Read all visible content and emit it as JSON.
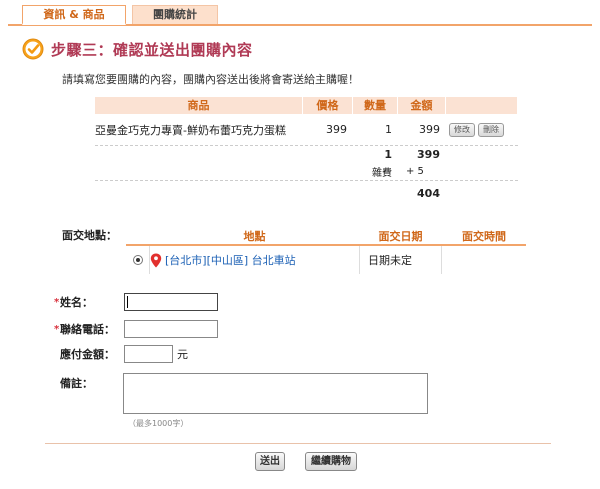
{
  "tabs": [
    {
      "label": "資訊 & 商品",
      "active": true
    },
    {
      "label": "團購統計",
      "active": false
    }
  ],
  "step": {
    "title": "步驟三：確認並送出團購內容"
  },
  "instruction": "請填寫您要團購的內容，團購內容送出後將會寄送給主購喔！",
  "products": {
    "headers": {
      "name": "商品",
      "price": "價格",
      "qty": "數量",
      "amount": "金額"
    },
    "rows": [
      {
        "name": "亞曼金巧克力專賣-鮮奶布蕾巧克力蛋糕",
        "price": "399",
        "qty": "1",
        "amount": "399",
        "edit_label": "修改",
        "delete_label": "刪除"
      }
    ],
    "subtotal_qty": "1",
    "subtotal_amount": "399",
    "fee_label": "雜費",
    "fee_value": "+ 5",
    "total": "404"
  },
  "meet": {
    "label": "面交地點：",
    "headers": {
      "location": "地點",
      "date": "面交日期",
      "time": "面交時間"
    },
    "rows": [
      {
        "location": "[台北市][中山區] 台北車站",
        "date": "日期未定",
        "time": ""
      }
    ]
  },
  "form": {
    "name_label": "姓名：",
    "phone_label": "聯絡電話：",
    "pay_label": "應付金額：",
    "pay_unit": "元",
    "note_label": "備註：",
    "note_hint": "（最多1000字）",
    "required_mark": "*"
  },
  "buttons": {
    "submit": "送出",
    "continue": "繼續購物"
  },
  "colors": {
    "accent": "#d0681a",
    "title": "#b03a55",
    "tab_border": "#f2a46a",
    "header_bg": "#fbe2d3"
  }
}
